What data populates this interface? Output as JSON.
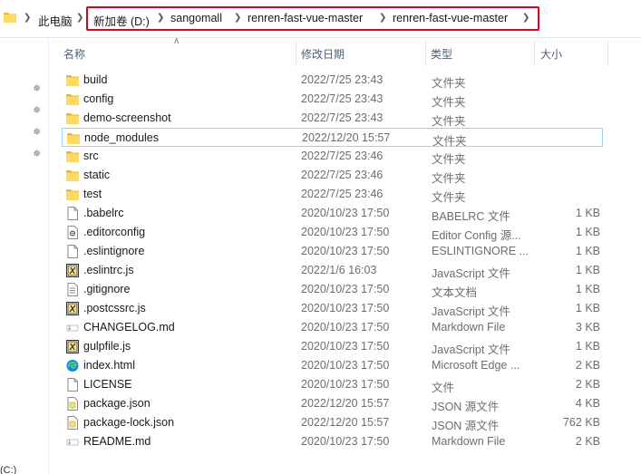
{
  "address": {
    "root": "此电脑",
    "breadcrumbs": [
      "新加卷 (D:)",
      "sangomall",
      "renren-fast-vue-master",
      "renren-fast-vue-master"
    ]
  },
  "columns": {
    "name": "名称",
    "date": "修改日期",
    "type": "类型",
    "size": "大小"
  },
  "nav": {
    "drive_stub": "(C:)"
  },
  "files": [
    {
      "name": "build",
      "date": "2022/7/25 23:43",
      "type": "文件夹",
      "size": "",
      "icon": "folder-icon"
    },
    {
      "name": "config",
      "date": "2022/7/25 23:43",
      "type": "文件夹",
      "size": "",
      "icon": "folder-icon"
    },
    {
      "name": "demo-screenshot",
      "date": "2022/7/25 23:43",
      "type": "文件夹",
      "size": "",
      "icon": "folder-icon"
    },
    {
      "name": "node_modules",
      "date": "2022/12/20 15:57",
      "type": "文件夹",
      "size": "",
      "icon": "folder-icon",
      "selected": true
    },
    {
      "name": "src",
      "date": "2022/7/25 23:46",
      "type": "文件夹",
      "size": "",
      "icon": "folder-icon"
    },
    {
      "name": "static",
      "date": "2022/7/25 23:46",
      "type": "文件夹",
      "size": "",
      "icon": "folder-icon"
    },
    {
      "name": "test",
      "date": "2022/7/25 23:46",
      "type": "文件夹",
      "size": "",
      "icon": "folder-icon"
    },
    {
      "name": ".babelrc",
      "date": "2020/10/23 17:50",
      "type": "BABELRC 文件",
      "size": "1 KB",
      "icon": "blank-file-icon"
    },
    {
      "name": ".editorconfig",
      "date": "2020/10/23 17:50",
      "type": "Editor Config 源...",
      "size": "1 KB",
      "icon": "config-file-icon"
    },
    {
      "name": ".eslintignore",
      "date": "2020/10/23 17:50",
      "type": "ESLINTIGNORE ...",
      "size": "1 KB",
      "icon": "blank-file-icon"
    },
    {
      "name": ".eslintrc.js",
      "date": "2022/1/6 16:03",
      "type": "JavaScript 文件",
      "size": "1 KB",
      "icon": "js-file-icon"
    },
    {
      "name": ".gitignore",
      "date": "2020/10/23 17:50",
      "type": "文本文档",
      "size": "1 KB",
      "icon": "text-file-icon"
    },
    {
      "name": ".postcssrc.js",
      "date": "2020/10/23 17:50",
      "type": "JavaScript 文件",
      "size": "1 KB",
      "icon": "js-file-icon"
    },
    {
      "name": "CHANGELOG.md",
      "date": "2020/10/23 17:50",
      "type": "Markdown File",
      "size": "3 KB",
      "icon": "markdown-file-icon"
    },
    {
      "name": "gulpfile.js",
      "date": "2020/10/23 17:50",
      "type": "JavaScript 文件",
      "size": "1 KB",
      "icon": "js-file-icon"
    },
    {
      "name": "index.html",
      "date": "2020/10/23 17:50",
      "type": "Microsoft Edge ...",
      "size": "2 KB",
      "icon": "edge-html-icon"
    },
    {
      "name": "LICENSE",
      "date": "2020/10/23 17:50",
      "type": "文件",
      "size": "2 KB",
      "icon": "blank-file-icon"
    },
    {
      "name": "package.json",
      "date": "2022/12/20 15:57",
      "type": "JSON 源文件",
      "size": "4 KB",
      "icon": "json-file-icon"
    },
    {
      "name": "package-lock.json",
      "date": "2022/12/20 15:57",
      "type": "JSON 源文件",
      "size": "762 KB",
      "icon": "json-file-icon"
    },
    {
      "name": "README.md",
      "date": "2020/10/23 17:50",
      "type": "Markdown File",
      "size": "2 KB",
      "icon": "markdown-file-icon"
    }
  ],
  "colors": {
    "folder": "#ffd966",
    "folder_dark": "#e8b73a",
    "highlight": "#e3001b",
    "selection_border": "#99d1ff",
    "header_text": "#4c607a"
  }
}
